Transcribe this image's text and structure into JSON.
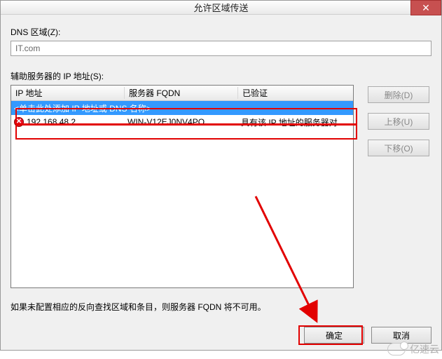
{
  "title": "允许区域传送",
  "dns_zone_label": "DNS 区域(Z):",
  "dns_zone_value": "IT.com",
  "servers_label": "辅助服务器的 IP 地址(S):",
  "columns": {
    "ip": "IP 地址",
    "fqdn": "服务器 FQDN",
    "validated": "已验证"
  },
  "input_placeholder": "<单击此处添加 IP 地址或 DNS 名称>",
  "rows": [
    {
      "icon": "error",
      "ip": "192.168.48.2",
      "fqdn": "WIN-V12EJ0NV4PO",
      "validated": "具有该 IP 地址的服务器对..."
    }
  ],
  "buttons": {
    "delete": "删除(D)",
    "up": "上移(U)",
    "down": "下移(O)",
    "ok": "确定",
    "cancel": "取消"
  },
  "note": "如果未配置相应的反向查找区域和条目，则服务器 FQDN 将不可用。",
  "watermark": "亿速云"
}
